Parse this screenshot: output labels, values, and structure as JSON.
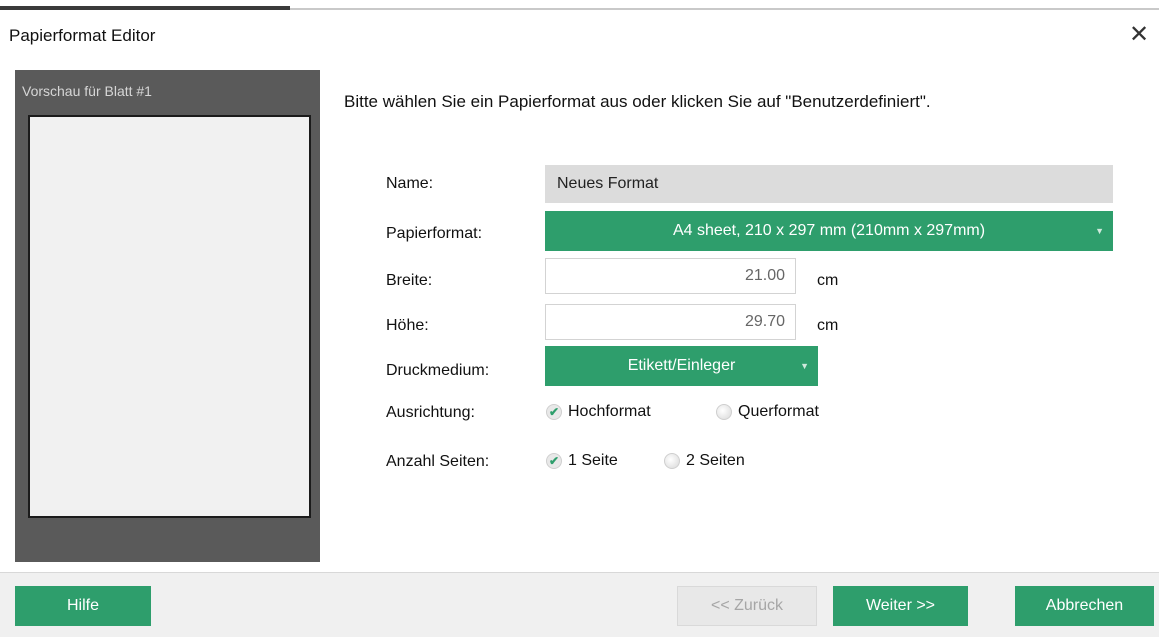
{
  "window": {
    "title": "Papierformat Editor",
    "close_icon": "close-icon",
    "close_glyph": "✕"
  },
  "preview": {
    "label": "Vorschau für Blatt #1"
  },
  "instruction": "Bitte wählen Sie ein Papierformat aus oder klicken Sie auf \"Benutzerdefiniert\".",
  "form": {
    "name": {
      "label": "Name:",
      "value": "Neues Format"
    },
    "paper_format": {
      "label": "Papierformat:",
      "selected": "A4 sheet, 210 x 297 mm (210mm x 297mm)"
    },
    "width": {
      "label": "Breite:",
      "value": "21.00",
      "unit": "cm"
    },
    "height": {
      "label": "Höhe:",
      "value": "29.70",
      "unit": "cm"
    },
    "medium": {
      "label": "Druckmedium:",
      "selected": "Etikett/Einleger"
    },
    "orientation": {
      "label": "Ausrichtung:",
      "options": [
        {
          "label": "Hochformat",
          "checked": true
        },
        {
          "label": "Querformat",
          "checked": false
        }
      ]
    },
    "pages": {
      "label": "Anzahl Seiten:",
      "options": [
        {
          "label": "1 Seite",
          "checked": true
        },
        {
          "label": "2 Seiten",
          "checked": false
        }
      ]
    }
  },
  "buttons": {
    "help": "Hilfe",
    "back": "<< Zurück",
    "next": "Weiter >>",
    "cancel": "Abbrechen"
  },
  "colors": {
    "accent": "#2e9e6c",
    "preview_panel": "#5a5a5a",
    "name_field": "#dcdcdc"
  },
  "glyphs": {
    "dropdown_arrow": "▼",
    "checkmark": "✔"
  }
}
